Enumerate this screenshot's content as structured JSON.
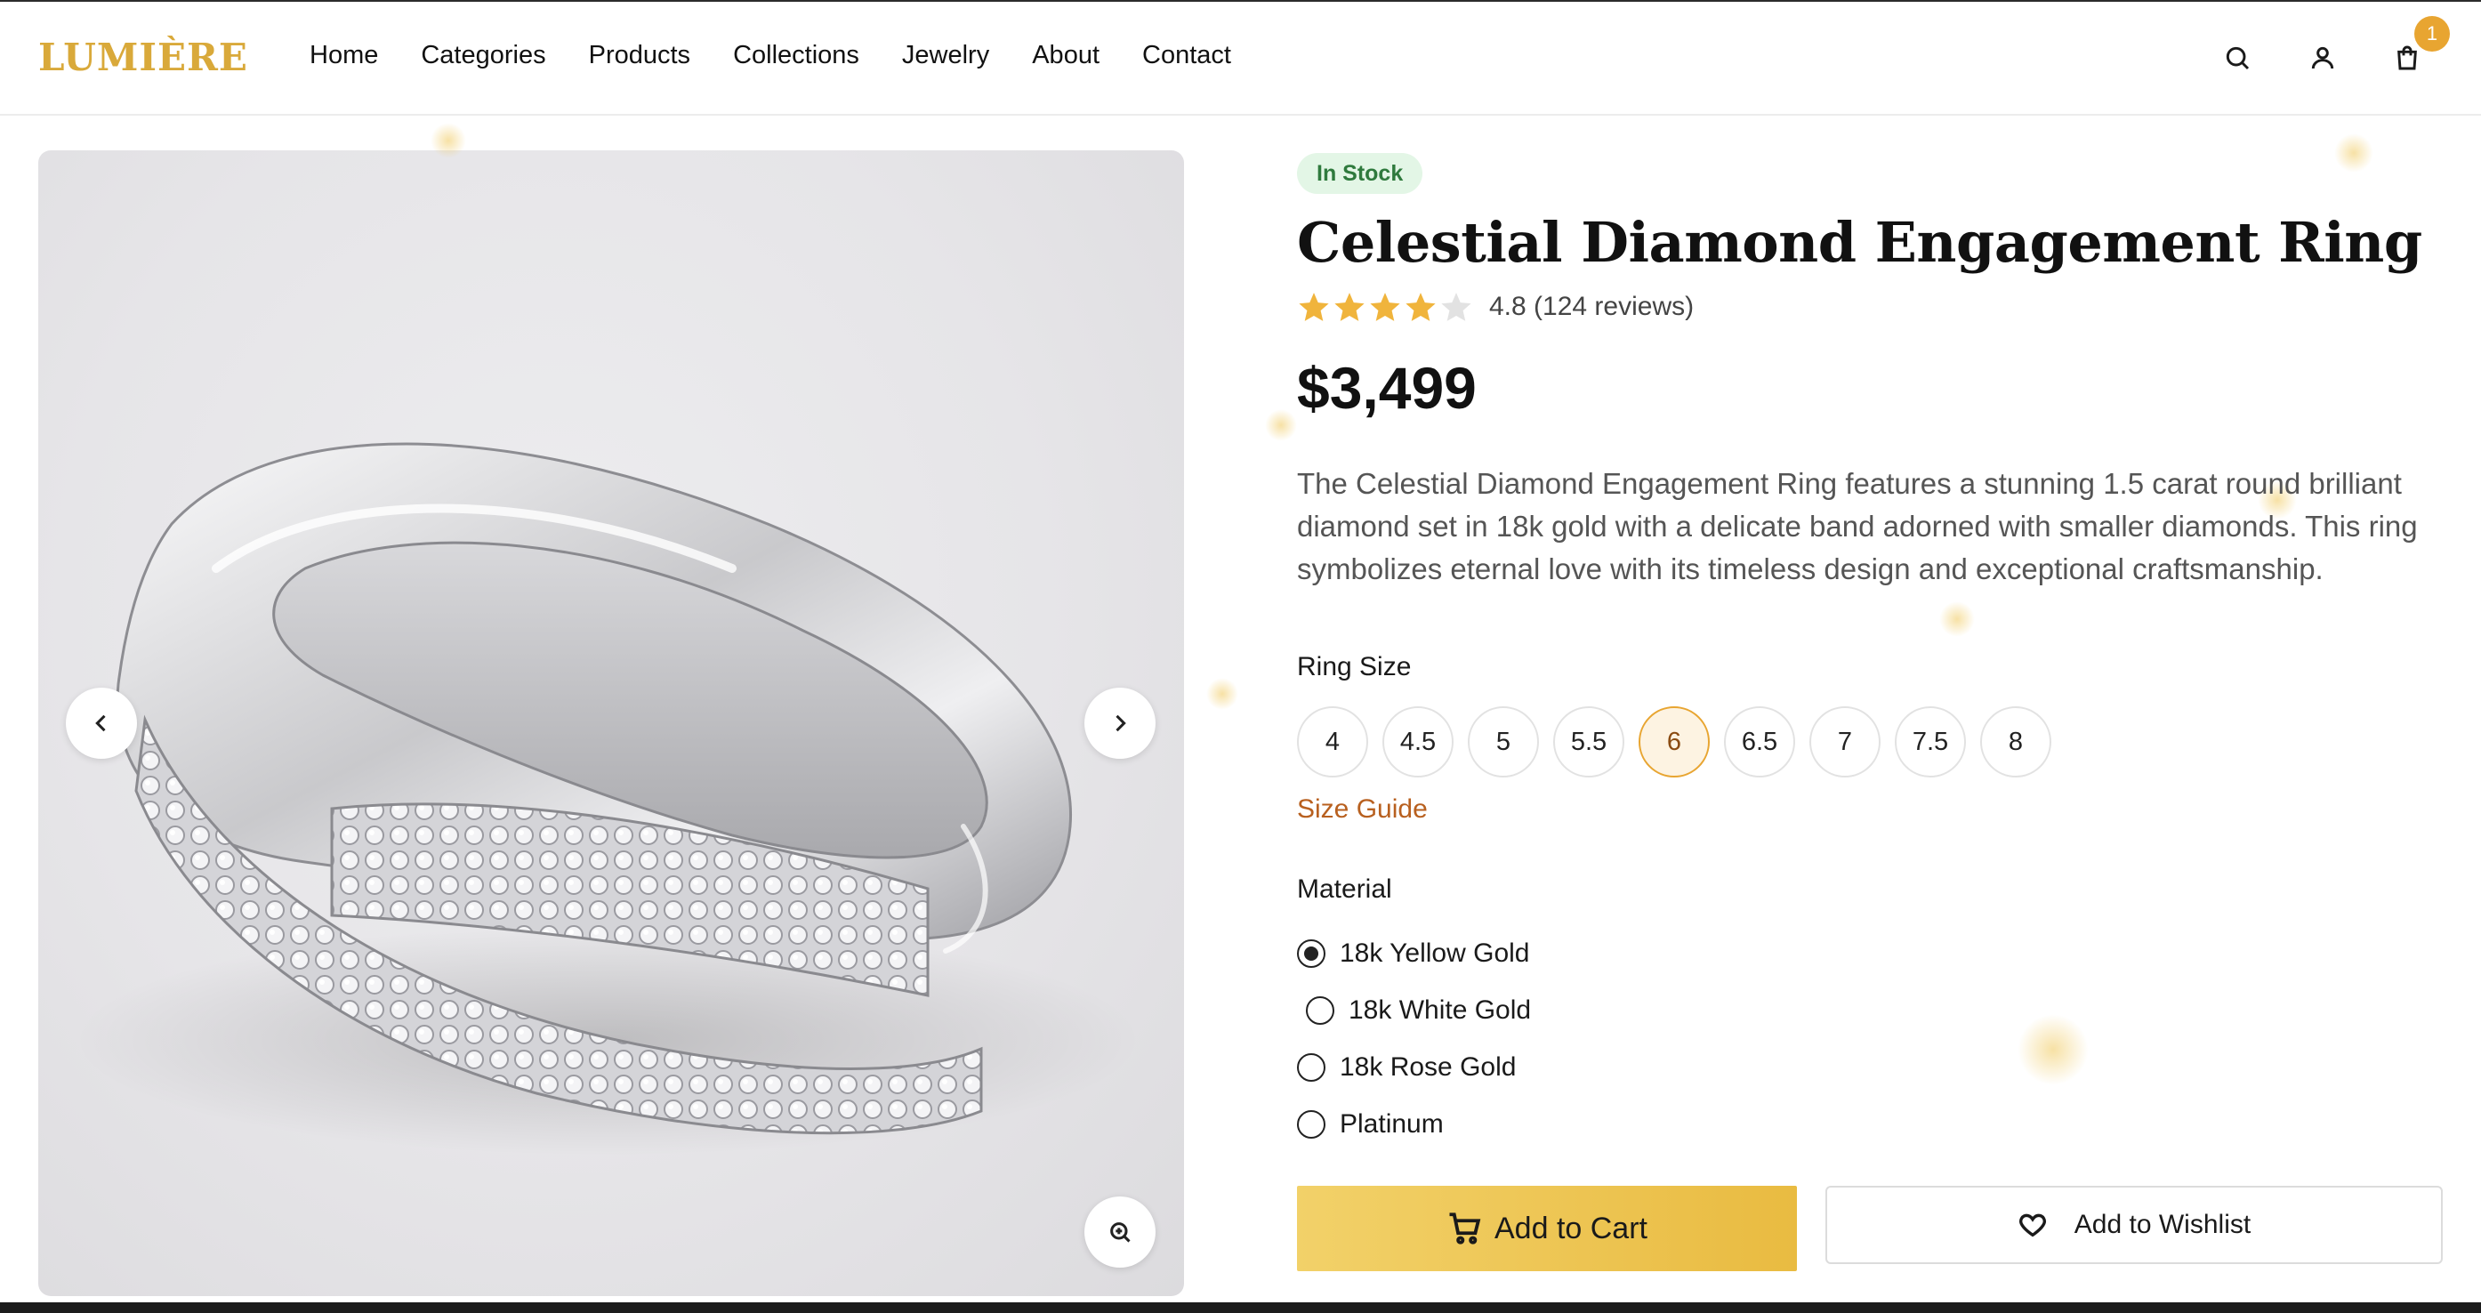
{
  "brand": {
    "logo": "LUMIÈRE",
    "accent_color": "#d9a93a"
  },
  "nav": {
    "items": [
      "Home",
      "Categories",
      "Products",
      "Collections",
      "Jewelry",
      "About",
      "Contact"
    ]
  },
  "header_icons": {
    "search": "search-icon",
    "account": "user-icon",
    "cart": "shopping-bag-icon",
    "cart_count": "1"
  },
  "gallery": {
    "image_description": "silver-diamond-ring",
    "prev_icon": "chevron-left-icon",
    "next_icon": "chevron-right-icon",
    "zoom_icon": "zoom-in-icon"
  },
  "product": {
    "stock_status": "In Stock",
    "title": "Celestial Diamond Engagement Ring",
    "rating_stars": 4,
    "rating_max": 5,
    "rating_text": "4.8 (124 reviews)",
    "price": "$3,499",
    "description": "The Celestial Diamond Engagement Ring features a stunning 1.5 carat round brilliant diamond set in 18k gold with a delicate band adorned with smaller diamonds. This ring symbolizes eternal love with its timeless design and exceptional craftsmanship."
  },
  "ring_size": {
    "label": "Ring Size",
    "options": [
      "4",
      "4.5",
      "5",
      "5.5",
      "6",
      "6.5",
      "7",
      "7.5",
      "8"
    ],
    "selected": "6",
    "guide_link": "Size Guide"
  },
  "material": {
    "label": "Material",
    "options": [
      "18k Yellow Gold",
      "18k White Gold",
      "18k Rose Gold",
      "Platinum"
    ],
    "selected": "18k Yellow Gold"
  },
  "actions": {
    "add_to_cart": "Add to Cart",
    "add_to_wishlist": "Add to Wishlist"
  }
}
